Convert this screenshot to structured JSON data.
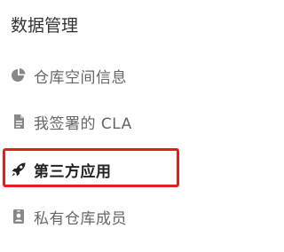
{
  "section": {
    "title": "数据管理"
  },
  "menu": {
    "items": [
      {
        "label": "仓库空间信息",
        "icon": "pie-chart-icon",
        "active": false
      },
      {
        "label": "我签署的 CLA",
        "icon": "document-icon",
        "active": false
      },
      {
        "label": "第三方应用",
        "icon": "rocket-icon",
        "active": true
      },
      {
        "label": "私有仓库成员",
        "icon": "id-badge-icon",
        "active": false
      }
    ]
  },
  "colors": {
    "icon_gray": "#888888",
    "text_gray": "#666666",
    "active_text": "#222222",
    "highlight_red": "#e02020"
  }
}
